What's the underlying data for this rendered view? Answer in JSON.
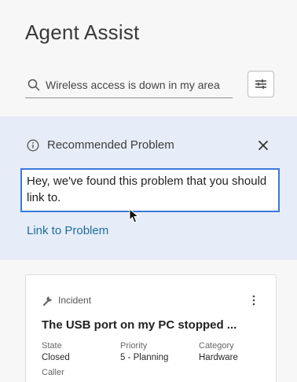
{
  "app": {
    "title": "Agent Assist"
  },
  "search": {
    "value": "Wireless access is down in my area"
  },
  "filter": {
    "icon": "filter-sliders-icon"
  },
  "recommendation": {
    "heading": "Recommended Problem",
    "message": "Hey, we've found this problem that you should link to.",
    "link_label": "Link to Problem",
    "colors": {
      "panel": "#e6edf8",
      "border": "#3a78d8",
      "link": "#1f6c9e"
    }
  },
  "card": {
    "type": "Incident",
    "title": "The USB port on my PC stopped ...",
    "fields": [
      {
        "label": "State",
        "value": "Closed"
      },
      {
        "label": "Priority",
        "value": "5 - Planning"
      },
      {
        "label": "Category",
        "value": "Hardware"
      }
    ],
    "caller_label": "Caller"
  }
}
